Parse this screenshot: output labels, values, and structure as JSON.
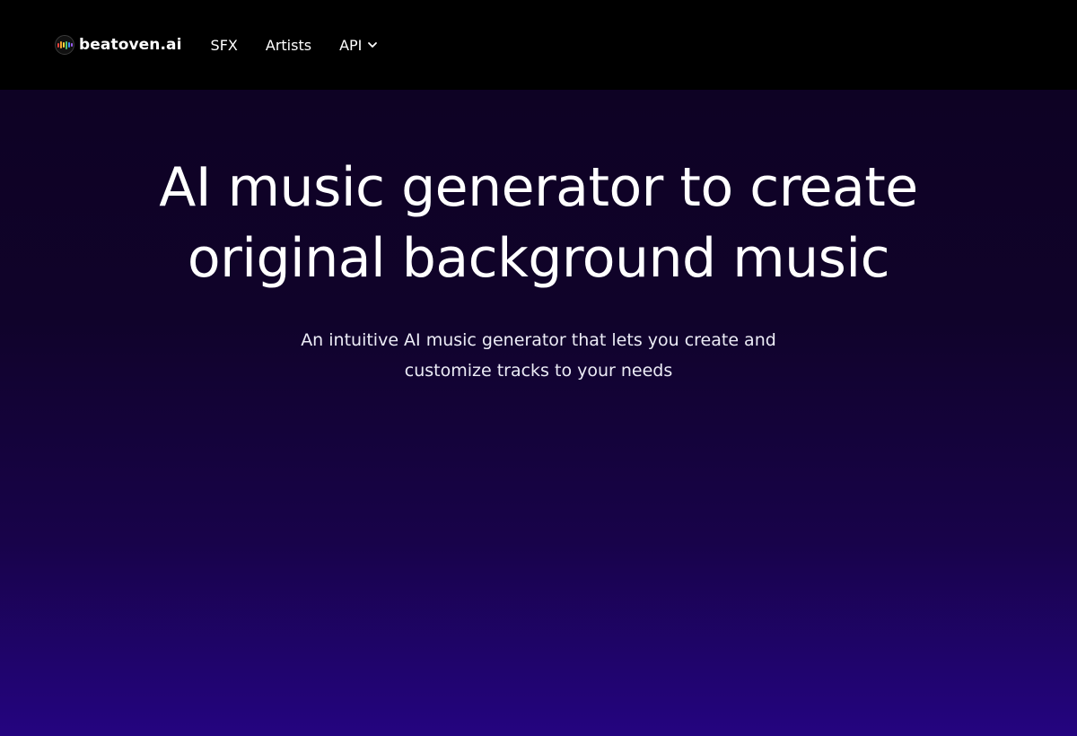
{
  "nav": {
    "logo_text": "beatoven.ai",
    "links": [
      {
        "label": "SFX"
      },
      {
        "label": "Artists"
      },
      {
        "label": "API"
      }
    ]
  },
  "hero": {
    "title_line1": "AI music generator to create",
    "title_line2": "original background music",
    "subtitle_line1": "An intuitive AI music generator that lets you create and",
    "subtitle_line2": "customize tracks to your needs"
  },
  "colors": {
    "nav_bg": "#000000",
    "hero_top": "#0e0224",
    "hero_bottom": "#240480",
    "logo_bars": [
      "#e8423b",
      "#f4a52f",
      "#f7d83a",
      "#4fc36a",
      "#3e8ef7",
      "#9b5cf6"
    ]
  },
  "icons": {
    "logo": "beatoven-waveform-logo-icon",
    "api_dropdown": "chevron-down-icon"
  }
}
